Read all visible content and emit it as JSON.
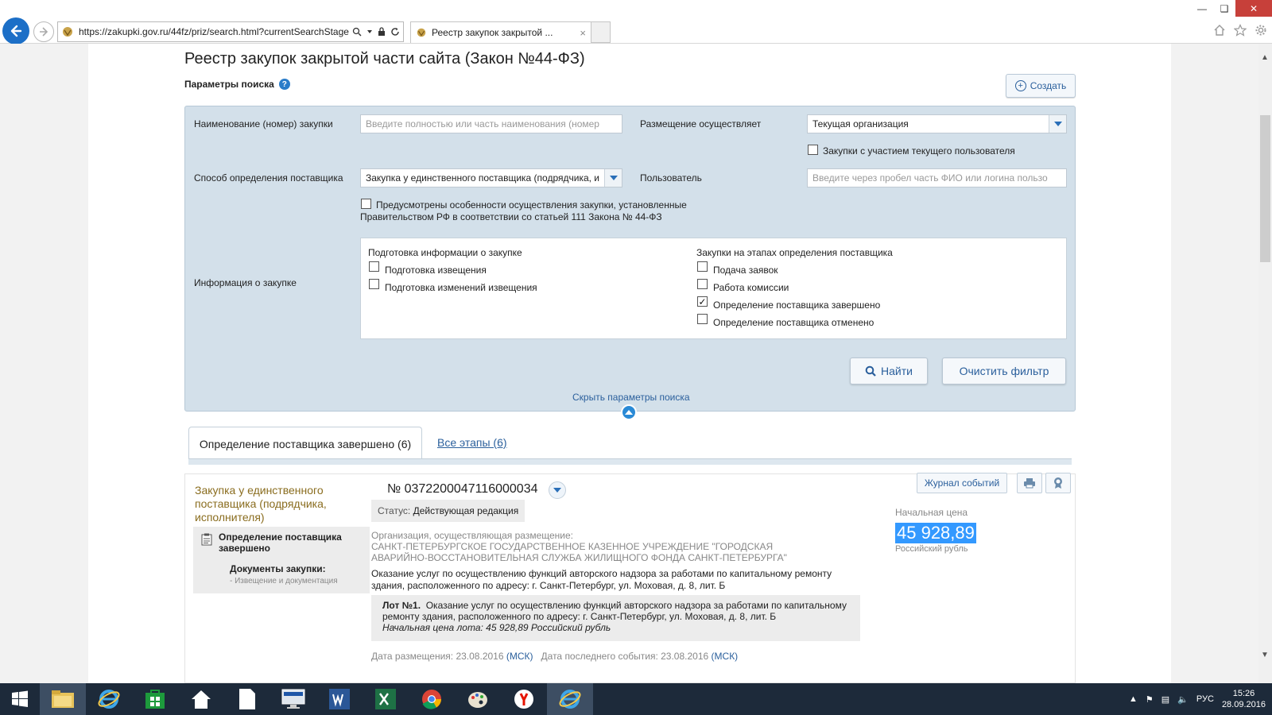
{
  "browser": {
    "url": "https://zakupki.gov.ru/44fz/priz/search.html?currentSearchStage:",
    "tab_title": "Реестр закупок закрытой ...",
    "tab_close": "×"
  },
  "page": {
    "title": "Реестр закупок закрытой части сайта (Закон №44-ФЗ)",
    "params_title": "Параметры поиска",
    "help": "?",
    "create_button": "Создать"
  },
  "search": {
    "name_label": "Наименование (номер) закупки",
    "name_placeholder": "Введите полностью или часть наименования (номер",
    "placement_label": "Размещение осуществляет",
    "placement_value": "Текущая организация",
    "user_participation_label": "Закупки с участием текущего пользователя",
    "method_label": "Способ определения поставщика",
    "method_value": "Закупка у единственного поставщика (подрядчика, и",
    "user_label": "Пользователь",
    "user_placeholder": "Введите через пробел часть ФИО или логина пользо",
    "special_line1": "Предусмотрены особенности осуществления закупки, установленные",
    "special_line2": "Правительством РФ в соответствии со статьей 111 Закона № 44-ФЗ",
    "info_label": "Информация о закупке",
    "prep_group": "Подготовка информации о закупке",
    "prep_items": [
      {
        "label": "Подготовка извещения",
        "checked": false
      },
      {
        "label": "Подготовка изменений извещения",
        "checked": false
      }
    ],
    "stage_group": "Закупки на этапах определения поставщика",
    "stage_items": [
      {
        "label": "Подача заявок",
        "checked": false
      },
      {
        "label": "Работа комиссии",
        "checked": false
      },
      {
        "label": "Определение поставщика завершено",
        "checked": true
      },
      {
        "label": "Определение поставщика отменено",
        "checked": false
      }
    ],
    "find_button": "Найти",
    "clear_button": "Очистить фильтр",
    "hide_link": "Скрыть параметры поиска"
  },
  "tabs": {
    "active": "Определение поставщика завершено (6)",
    "all": "Все этапы (6)"
  },
  "result": {
    "proc_type": "Закупка у единственного поставщика (подрядчика, исполнителя)",
    "stage_title": "Определение поставщика завершено",
    "docs_title": "Документы закупки:",
    "docs_sub": "- Извещение и документация",
    "number": "№ 0372200047116000034",
    "status_label": "Статус:",
    "status_value": "Действующая редакция",
    "org_label": "Организация, осуществляющая размещение:",
    "org_name": "САНКТ-ПЕТЕРБУРГСКОЕ ГОСУДАРСТВЕННОЕ КАЗЕННОЕ УЧРЕЖДЕНИЕ \"ГОРОДСКАЯ АВАРИЙНО-ВОССТАНОВИТЕЛЬНАЯ СЛУЖБА ЖИЛИЩНОГО ФОНДА САНКТ-ПЕТЕРБУРГА\"",
    "description": "Оказание услуг по осуществлению функций авторского надзора за работами по капитальному ремонту здания, расположенного по адресу: г. Санкт-Петербург, ул. Моховая, д. 8, лит. Б",
    "lot_number": "Лот №1.",
    "lot_text": "Оказание услуг по осуществлению функций авторского надзора за работами по капитальному ремонту здания, расположенного по адресу: г. Санкт-Петербург, ул. Моховая, д. 8, лит. Б",
    "lot_price": "Начальная цена лота: 45 928,89 Российский рубль",
    "posted_label": "Дата размещения: 23.08.2016",
    "last_event_label": "Дата последнего события: 23.08.2016",
    "msk": "(МСК)",
    "journal_button": "Журнал событий",
    "price_label": "Начальная цена",
    "price_value": "45 928,89",
    "price_currency": "Российский рубль"
  },
  "taskbar": {
    "lang": "РУС",
    "time": "15:26",
    "date": "28.09.2016"
  },
  "colors": {
    "panel": "#d3e0ea",
    "link": "#2a5f9c",
    "accent": "#1c6fc7",
    "proc_type": "#8a6d1f"
  }
}
